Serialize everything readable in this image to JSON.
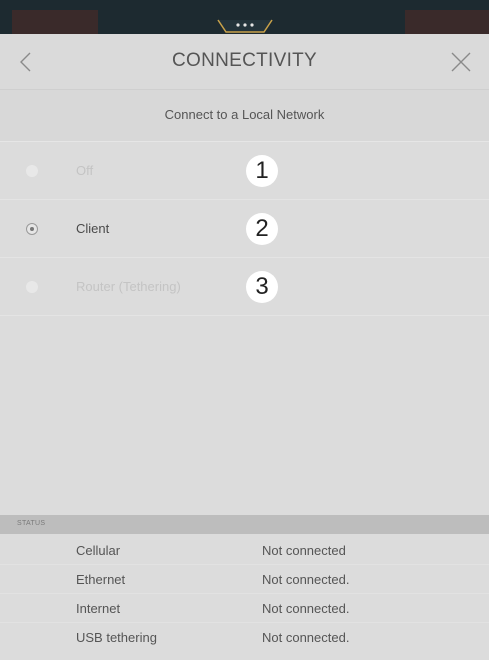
{
  "header": {
    "title": "CONNECTIVITY"
  },
  "handle": {
    "glyph": "• • •"
  },
  "subheader": {
    "text": "Connect to a Local Network"
  },
  "options": [
    {
      "label": "Off",
      "number": "1",
      "selected": false,
      "enabled": false
    },
    {
      "label": "Client",
      "number": "2",
      "selected": true,
      "enabled": true
    },
    {
      "label": "Router (Tethering)",
      "number": "3",
      "selected": false,
      "enabled": false
    }
  ],
  "status": {
    "heading": "STATUS",
    "rows": [
      {
        "key": "Cellular",
        "value": "Not connected"
      },
      {
        "key": "Ethernet",
        "value": "Not connected."
      },
      {
        "key": "Internet",
        "value": "Not connected."
      },
      {
        "key": "USB tethering",
        "value": "Not connected."
      }
    ]
  },
  "colors": {
    "background": "#dcdcdc",
    "top_strip": "#1d2a30",
    "handle_accent": "#c9a24a",
    "status_bar": "#bdbdbd"
  }
}
